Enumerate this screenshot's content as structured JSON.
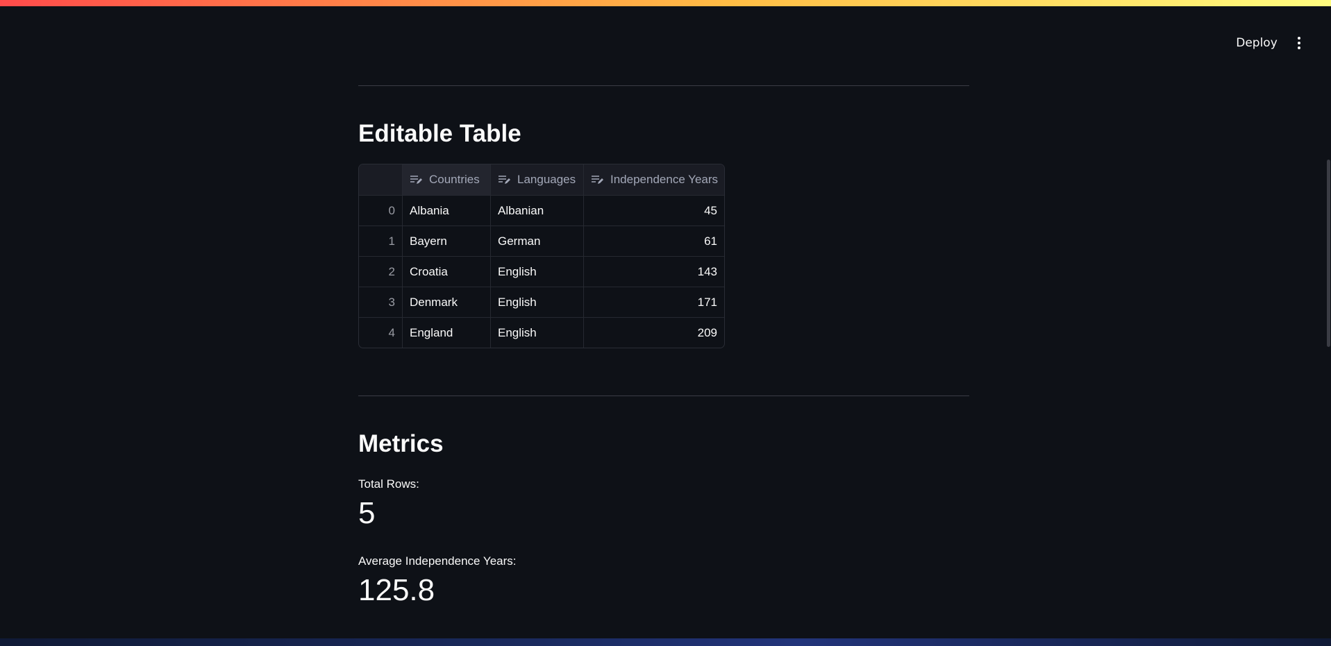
{
  "header": {
    "deploy_label": "Deploy",
    "menu_icon": "more-vertical-icon"
  },
  "colors": {
    "background": "#0e1117",
    "accent_gradient": [
      "#ff4b4b",
      "#ffbd45",
      "#fffd80"
    ],
    "text": "#fafafa"
  },
  "editable_table": {
    "title": "Editable Table",
    "columns": [
      {
        "label": "Countries",
        "icon": "edit-text-icon"
      },
      {
        "label": "Languages",
        "icon": "edit-text-icon"
      },
      {
        "label": "Independence Years",
        "icon": "edit-text-icon"
      }
    ],
    "rows": [
      {
        "index": "0",
        "country": "Albania",
        "language": "Albanian",
        "years": "45"
      },
      {
        "index": "1",
        "country": "Bayern",
        "language": "German",
        "years": "61"
      },
      {
        "index": "2",
        "country": "Croatia",
        "language": "English",
        "years": "143"
      },
      {
        "index": "3",
        "country": "Denmark",
        "language": "English",
        "years": "171"
      },
      {
        "index": "4",
        "country": "England",
        "language": "English",
        "years": "209"
      }
    ]
  },
  "metrics": {
    "title": "Metrics",
    "total_rows_label": "Total Rows:",
    "total_rows_value": "5",
    "avg_years_label": "Average Independence Years:",
    "avg_years_value": "125.8"
  }
}
